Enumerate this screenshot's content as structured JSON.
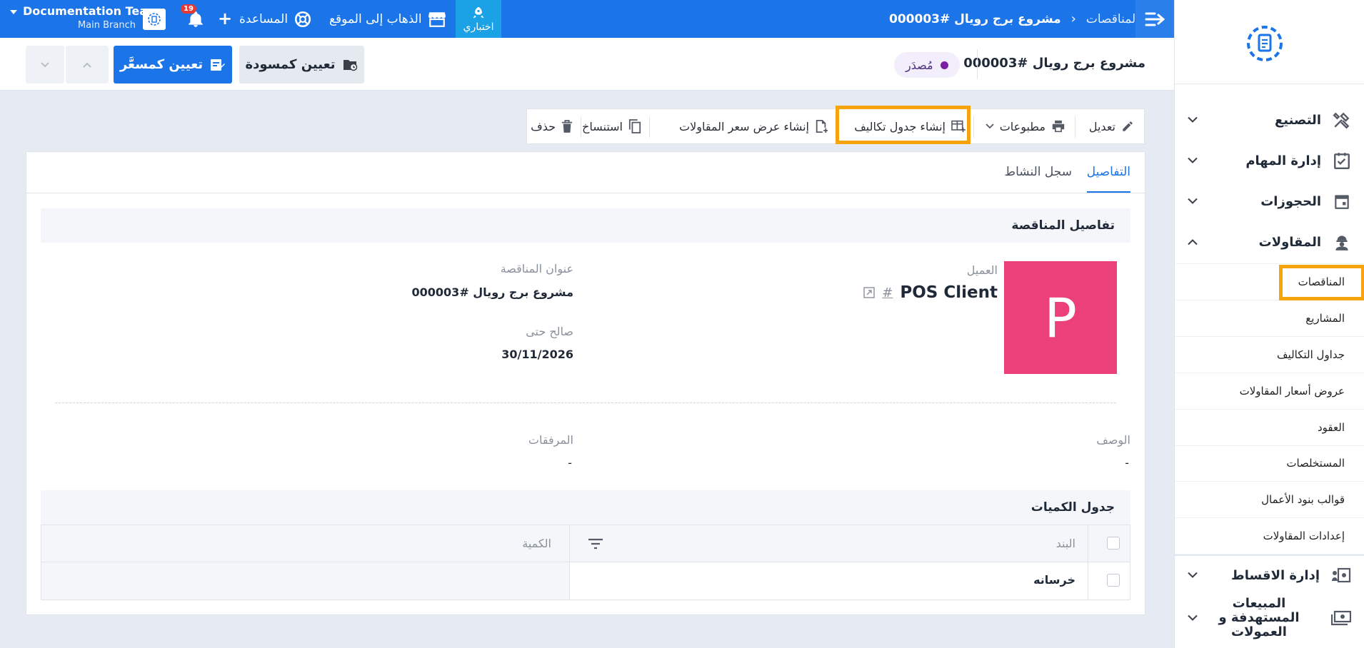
{
  "topbar": {
    "team_name": "Documentation Team",
    "branch": "Main Branch",
    "notifications_count": "19",
    "help_label": "المساعدة",
    "goto_site_label": "الذهاب إلى الموقع",
    "trial_label": "اختباري",
    "breadcrumb_parent": "المناقصات",
    "breadcrumb_current": "مشروع برج رويال #000003",
    "colors": {
      "bar": "#1b75e8",
      "trial": "#1aa1e6"
    }
  },
  "header": {
    "title": "مشروع برج رويال #000003",
    "status_badge": "مُصدَر",
    "set_draft_label": "تعيين كمسودة",
    "set_priced_label": "تعيين كمسعَّر"
  },
  "toolbar": {
    "edit": "تعديل",
    "prints": "مطبوعات",
    "create_cost_sheet": "إنشاء جدول تكاليف",
    "create_quote": "إنشاء عرض سعر المقاولات",
    "copy": "استنساخ",
    "delete": "حذف"
  },
  "tabs": [
    {
      "label": "التفاصيل",
      "active": true
    },
    {
      "label": "سجل النشاط",
      "active": false
    }
  ],
  "details": {
    "section_title": "تفاصيل المناقصة",
    "avatar_letter": "P",
    "avatar_color": "#ec407a",
    "client_label": "العميل",
    "client_name": "POS Client",
    "client_hash": "#",
    "tender_title_label": "عنوان المناقصة",
    "tender_title_value": "مشروع برج رويال #000003",
    "valid_until_label": "صالح حتى",
    "valid_until_value": "30/11/2026",
    "description_label": "الوصف",
    "description_value": "-",
    "attachments_label": "المرفقات",
    "attachments_value": "-"
  },
  "quantities": {
    "section_title": "جدول الكميات",
    "col_item": "البند",
    "col_qty": "الكمية",
    "rows": [
      {
        "item": "خرسانه",
        "qty": ""
      }
    ]
  },
  "sidebar": {
    "menu": [
      {
        "label": "التصنيع",
        "icon": "tools-icon",
        "expanded": false
      },
      {
        "label": "إدارة المهام",
        "icon": "task-icon",
        "expanded": false
      },
      {
        "label": "الحجوزات",
        "icon": "calendar-icon",
        "expanded": false
      },
      {
        "label": "المقاولات",
        "icon": "worker-icon",
        "expanded": true
      }
    ],
    "sub_items": [
      {
        "label": "المناقصات",
        "active": true
      },
      {
        "label": "المشاريع"
      },
      {
        "label": "جداول التكاليف"
      },
      {
        "label": "عروض أسعار المقاولات"
      },
      {
        "label": "العقود"
      },
      {
        "label": "المستخلصات"
      },
      {
        "label": "قوالب بنود الأعمال"
      },
      {
        "label": "إعدادات المقاولات"
      }
    ],
    "menu_bottom": [
      {
        "label": "إدارة الاقساط",
        "icon": "installments-icon"
      },
      {
        "label": "المبيعات المستهدفة و العمولات",
        "icon": "money-icon"
      }
    ]
  },
  "highlight_color": "#f5a40d"
}
